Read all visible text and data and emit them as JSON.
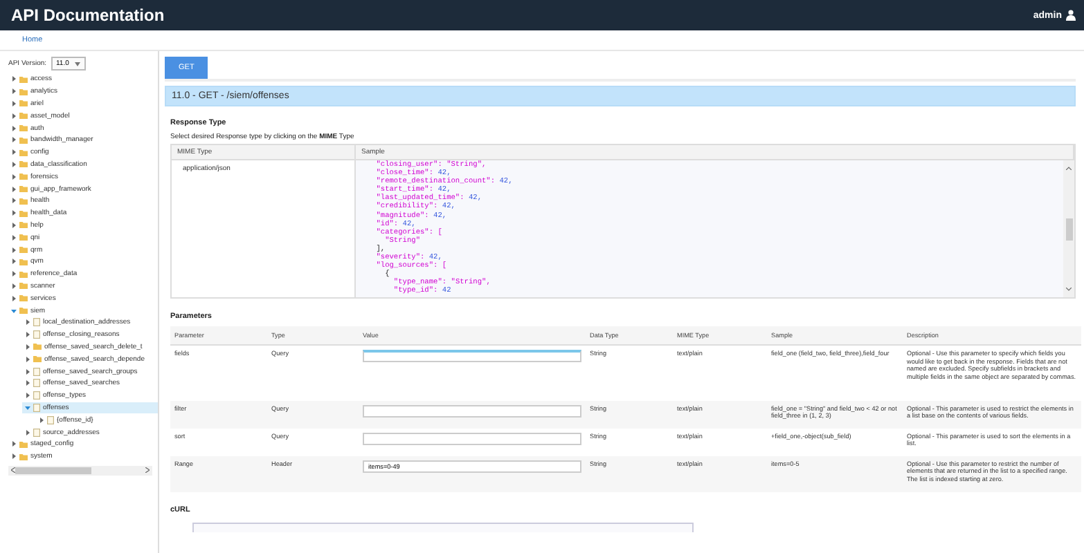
{
  "header": {
    "title": "API Documentation",
    "user": "admin"
  },
  "breadcrumb": "Home",
  "sidebar": {
    "version_label": "API Version:",
    "version": "11.0",
    "tree": [
      {
        "label": "access",
        "kind": "folder",
        "expanded": false,
        "selected": false
      },
      {
        "label": "analytics",
        "kind": "folder",
        "expanded": false,
        "selected": false
      },
      {
        "label": "ariel",
        "kind": "folder",
        "expanded": false,
        "selected": false
      },
      {
        "label": "asset_model",
        "kind": "folder",
        "expanded": false,
        "selected": false
      },
      {
        "label": "auth",
        "kind": "folder",
        "expanded": false,
        "selected": false
      },
      {
        "label": "bandwidth_manager",
        "kind": "folder",
        "expanded": false,
        "selected": false
      },
      {
        "label": "config",
        "kind": "folder",
        "expanded": false,
        "selected": false
      },
      {
        "label": "data_classification",
        "kind": "folder",
        "expanded": false,
        "selected": false
      },
      {
        "label": "forensics",
        "kind": "folder",
        "expanded": false,
        "selected": false
      },
      {
        "label": "gui_app_framework",
        "kind": "folder",
        "expanded": false,
        "selected": false
      },
      {
        "label": "health",
        "kind": "folder",
        "expanded": false,
        "selected": false
      },
      {
        "label": "health_data",
        "kind": "folder",
        "expanded": false,
        "selected": false
      },
      {
        "label": "help",
        "kind": "folder",
        "expanded": false,
        "selected": false
      },
      {
        "label": "qni",
        "kind": "folder",
        "expanded": false,
        "selected": false
      },
      {
        "label": "qrm",
        "kind": "folder",
        "expanded": false,
        "selected": false
      },
      {
        "label": "qvm",
        "kind": "folder",
        "expanded": false,
        "selected": false
      },
      {
        "label": "reference_data",
        "kind": "folder",
        "expanded": false,
        "selected": false
      },
      {
        "label": "scanner",
        "kind": "folder",
        "expanded": false,
        "selected": false
      },
      {
        "label": "services",
        "kind": "folder",
        "expanded": false,
        "selected": false
      },
      {
        "label": "siem",
        "kind": "folder",
        "expanded": true,
        "selected": false,
        "children": [
          {
            "label": "local_destination_addresses",
            "kind": "document",
            "expanded": false,
            "selected": false
          },
          {
            "label": "offense_closing_reasons",
            "kind": "document",
            "expanded": false,
            "selected": false
          },
          {
            "label": "offense_saved_search_delete_t",
            "kind": "folder",
            "expanded": false,
            "selected": false
          },
          {
            "label": "offense_saved_search_depende",
            "kind": "folder",
            "expanded": false,
            "selected": false
          },
          {
            "label": "offense_saved_search_groups",
            "kind": "document",
            "expanded": false,
            "selected": false
          },
          {
            "label": "offense_saved_searches",
            "kind": "document",
            "expanded": false,
            "selected": false
          },
          {
            "label": "offense_types",
            "kind": "document",
            "expanded": false,
            "selected": false
          },
          {
            "label": "offenses",
            "kind": "document",
            "expanded": true,
            "selected": true,
            "children": [
              {
                "label": "{offense_id}",
                "kind": "document",
                "expanded": false,
                "selected": false
              }
            ]
          },
          {
            "label": "source_addresses",
            "kind": "document",
            "expanded": false,
            "selected": false
          }
        ]
      },
      {
        "label": "staged_config",
        "kind": "folder",
        "expanded": false,
        "selected": false
      },
      {
        "label": "system",
        "kind": "folder",
        "expanded": false,
        "selected": false
      }
    ]
  },
  "method_tabs": [
    {
      "label": "GET",
      "selected": true
    }
  ],
  "endpoint_title": "11.0 - GET - /siem/offenses",
  "response": {
    "heading": "Response Type",
    "hint": "Select desired Response type by clicking on the **MIME** Type",
    "columns": [
      "MIME Type",
      "Sample"
    ],
    "mime_type": "application/json",
    "sample_lines": [
      {
        "key": "    \"closing_user\": ",
        "value": "\"String\",",
        "kind": "string"
      },
      {
        "key": "    \"close_time\": ",
        "value": "42,",
        "kind": "number"
      },
      {
        "key": "    \"remote_destination_count\": ",
        "value": "42,",
        "kind": "number"
      },
      {
        "key": "    \"start_time\": ",
        "value": "42,",
        "kind": "number"
      },
      {
        "key": "    \"last_updated_time\": ",
        "value": "42,",
        "kind": "number"
      },
      {
        "key": "    \"credibility\": ",
        "value": "42,",
        "kind": "number"
      },
      {
        "key": "    \"magnitude\": ",
        "value": "42,",
        "kind": "number"
      },
      {
        "key": "    \"id\": ",
        "value": "42,",
        "kind": "number"
      },
      {
        "key": "    \"categories\": [",
        "kind": "plain"
      },
      {
        "key": "      \"String\"",
        "kind": "plain"
      },
      {
        "key": "    ],",
        "kind": "plain"
      },
      {
        "key": "    \"severity\": ",
        "value": "42,",
        "kind": "number"
      },
      {
        "key": "    \"log_sources\": [",
        "kind": "plain"
      },
      {
        "key": "      {",
        "kind": "plain"
      },
      {
        "key": "        \"type_name\": ",
        "value": "\"String\",",
        "kind": "string"
      },
      {
        "key": "        \"type_id\": ",
        "value": "42",
        "kind": "number"
      }
    ]
  },
  "parameters": {
    "heading": "Parameters",
    "columns": [
      "Parameter",
      "Type",
      "Value",
      "Data Type",
      "MIME Type",
      "Sample",
      "Description"
    ],
    "rows": [
      {
        "parameter": "fields",
        "type": "Query",
        "value": "",
        "focused": true,
        "data_type": "String",
        "mime_type": "text/plain",
        "sample": "field_one (field_two, field_three),field_four",
        "description": "Optional - Use this parameter to specify which fields you would like to get back in the response. Fields that are not named are excluded. Specify subfields in brackets and multiple fields in the same object are separated by commas."
      },
      {
        "parameter": "filter",
        "type": "Query",
        "value": "",
        "focused": false,
        "data_type": "String",
        "mime_type": "text/plain",
        "sample": "field_one = \"String\" and field_two < 42 or not field_three in (1, 2, 3)",
        "description": "Optional - This parameter is used to restrict the elements in a list base on the contents of various fields."
      },
      {
        "parameter": "sort",
        "type": "Query",
        "value": "",
        "focused": false,
        "data_type": "String",
        "mime_type": "text/plain",
        "sample": "+field_one,-object(sub_field)",
        "description": "Optional - This parameter is used to sort the elements in a list."
      },
      {
        "parameter": "Range",
        "type": "Header",
        "value": "items=0-49",
        "focused": false,
        "data_type": "String",
        "mime_type": "text/plain",
        "sample": "items=0-5",
        "description": "Optional - Use this parameter to restrict the number of elements that are returned in the list to a specified range. The list is indexed starting at zero."
      }
    ]
  },
  "curl_heading": "cURL"
}
